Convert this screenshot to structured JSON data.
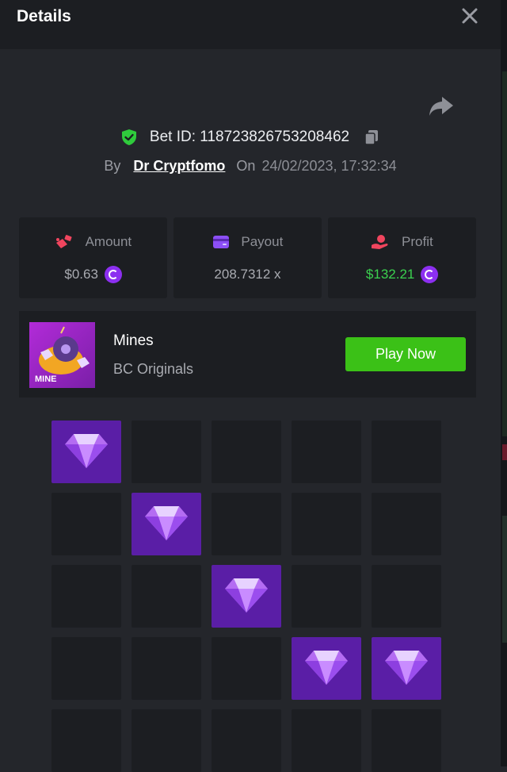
{
  "header": {
    "title": "Details",
    "close_icon": "close-icon"
  },
  "bet": {
    "label": "Bet ID:",
    "id": "118723826753208462",
    "by_label": "By",
    "user": "Dr Cryptfomo",
    "on_label": "On",
    "datetime": "24/02/2023, 17:32:34"
  },
  "stats": {
    "amount": {
      "label": "Amount",
      "value": "$0.63"
    },
    "payout": {
      "label": "Payout",
      "value": "208.7312 x"
    },
    "profit": {
      "label": "Profit",
      "value": "$132.21"
    }
  },
  "game": {
    "name": "Mines",
    "provider": "BC Originals",
    "thumb_text": "MINE",
    "play_label": "Play Now"
  },
  "board": {
    "columns": 5,
    "gem_cells": [
      [
        0,
        0
      ],
      [
        1,
        1
      ],
      [
        2,
        2
      ],
      [
        3,
        3
      ],
      [
        3,
        4
      ]
    ],
    "visible_rows": 5
  },
  "colors": {
    "accent_green": "#3bc117",
    "profit_green": "#3bd14f",
    "gem_tile": "#5a1ea6",
    "coin": "#8c2ff0",
    "shield": "#2fcb3c"
  }
}
